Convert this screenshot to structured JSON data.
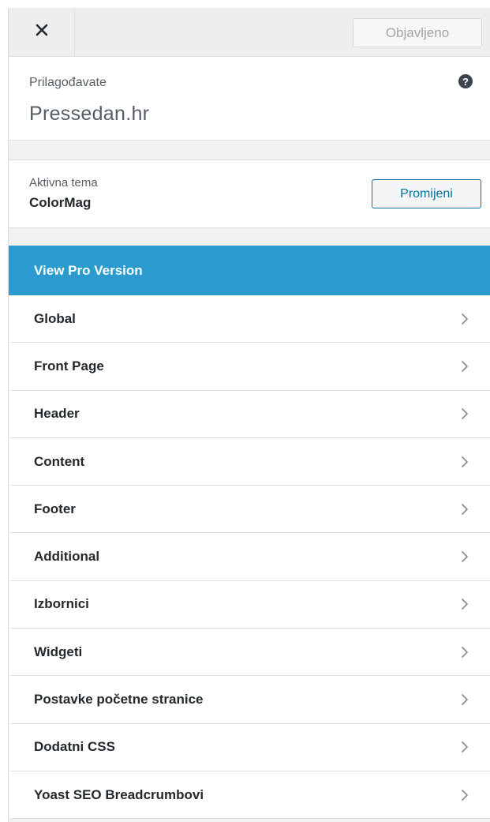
{
  "header": {
    "close_icon": "close-icon",
    "publish_label": "Objavljeno"
  },
  "info": {
    "label": "Prilagođavate",
    "site_title": "Pressedan.hr",
    "help_glyph": "?"
  },
  "theme": {
    "label": "Aktivna tema",
    "name": "ColorMag",
    "change_label": "Promijeni"
  },
  "menu": {
    "pro_label": "View Pro Version",
    "pro_color": "#2b9bcf",
    "items": [
      {
        "label": "Global"
      },
      {
        "label": "Front Page"
      },
      {
        "label": "Header"
      },
      {
        "label": "Content"
      },
      {
        "label": "Footer"
      },
      {
        "label": "Additional"
      },
      {
        "label": "Izbornici"
      },
      {
        "label": "Widgeti"
      },
      {
        "label": "Postavke početne stranice"
      },
      {
        "label": "Dodatni CSS"
      },
      {
        "label": "Yoast SEO Breadcrumbovi"
      }
    ]
  }
}
